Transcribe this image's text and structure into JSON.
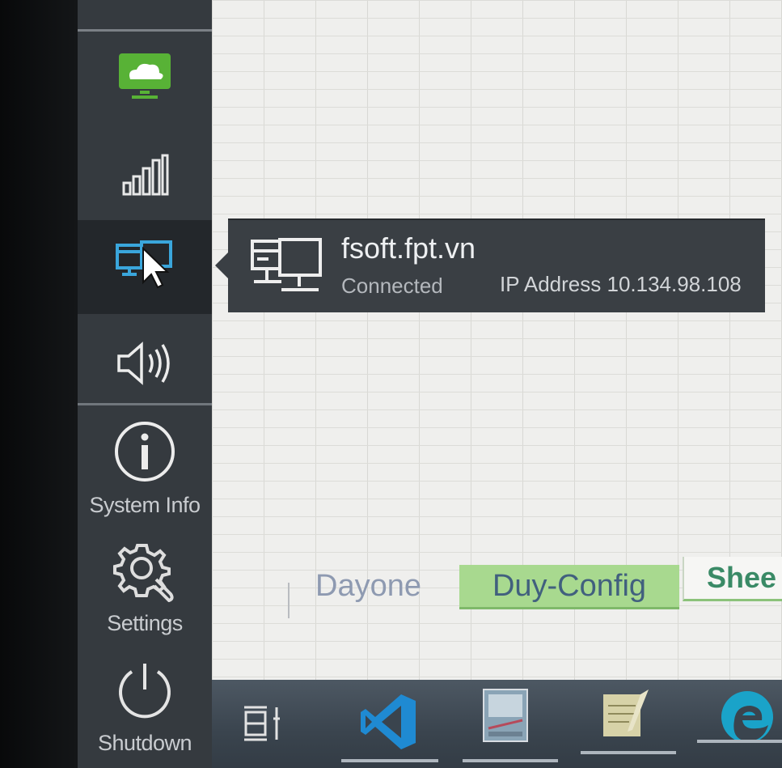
{
  "sidebar": {
    "items": [
      {
        "icon": "cloud-monitor-icon"
      },
      {
        "icon": "signal-bars-icon"
      },
      {
        "icon": "network-icon",
        "active": true
      },
      {
        "icon": "speaker-icon"
      },
      {
        "icon": "info-icon",
        "label": "System Info"
      },
      {
        "icon": "gear-wrench-icon",
        "label": "Settings"
      },
      {
        "icon": "power-icon",
        "label": "Shutdown"
      }
    ]
  },
  "network_popup": {
    "name": "fsoft.fpt.vn",
    "status": "Connected",
    "ip": "IP Address 10.134.98.108"
  },
  "sheet_tabs": [
    "Dayone",
    "Duy-Config",
    "Shee"
  ],
  "taskbar": {
    "apps": [
      "desktop-switcher-icon",
      "vscode-icon",
      "image-editor-icon",
      "notepad-icon",
      "edge-browser-icon"
    ]
  },
  "colors": {
    "sidebar_bg": "#353a3f",
    "active_tab": "#a8d98f",
    "popup_bg": "#3a3f44"
  }
}
